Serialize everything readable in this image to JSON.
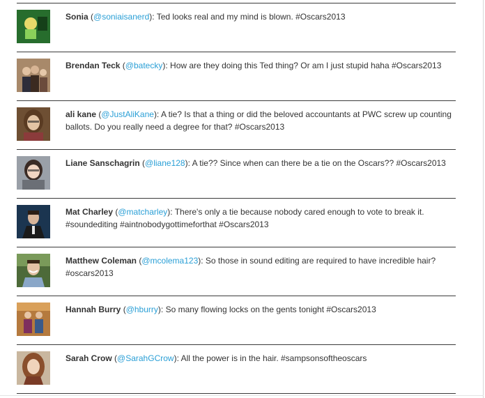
{
  "tweets": [
    {
      "name": "Sonia",
      "handle": "@soniaisanerd",
      "text": "Ted looks real and my mind is blown. #Oscars2013",
      "avatar_icon": "avatar-sonia",
      "colors": {
        "bg": "#1f6b2a",
        "fg": "#e8d96a"
      }
    },
    {
      "name": "Brendan Teck",
      "handle": "@batecky",
      "text": "How are they doing this Ted thing? Or am I just stupid haha #Oscars2013",
      "avatar_icon": "avatar-brendan",
      "colors": {
        "bg": "#a88a6c",
        "fg": "#3b2a20"
      }
    },
    {
      "name": "ali kane",
      "handle": "@JustAliKane",
      "text": "A tie? Is that a thing or did the beloved accountants at PWC screw up counting ballots. Do you really need a degree for that? #Oscars2013",
      "avatar_icon": "avatar-ali",
      "colors": {
        "bg": "#7a5a3c",
        "fg": "#e3c4a4"
      }
    },
    {
      "name": "Liane Sanschagrin",
      "handle": "@liane128",
      "text": "A tie?? Since when can there be a tie on the Oscars?? #Oscars2013",
      "avatar_icon": "avatar-liane",
      "colors": {
        "bg": "#8a8f96",
        "fg": "#f1d5c2"
      }
    },
    {
      "name": "Mat Charley",
      "handle": "@matcharley",
      "text": "There's only a tie because nobody cared enough to vote to break it. #soundediting #aintnobodygottimeforthat #Oscars2013",
      "avatar_icon": "avatar-mat",
      "colors": {
        "bg": "#1d3a57",
        "fg": "#d8b59a"
      }
    },
    {
      "name": "Matthew Coleman",
      "handle": "@mcolema123",
      "text": "So those in sound editing are required to have incredible hair? #oscars2013",
      "avatar_icon": "avatar-matthew",
      "colors": {
        "bg": "#4e6b3a",
        "fg": "#e4c3a6"
      }
    },
    {
      "name": "Hannah Burry",
      "handle": "@hburry",
      "text": "So many flowing locks on the gents tonight #Oscars2013",
      "avatar_icon": "avatar-hannah",
      "colors": {
        "bg": "#9b5c2e",
        "fg": "#7e2f5e"
      }
    },
    {
      "name": "Sarah Crow",
      "handle": "@SarahGCrow",
      "text": "All the power is in the hair. #sampsonsoftheoscars",
      "avatar_icon": "avatar-sarah",
      "colors": {
        "bg": "#b8a48c",
        "fg": "#8a4f2c"
      }
    }
  ]
}
